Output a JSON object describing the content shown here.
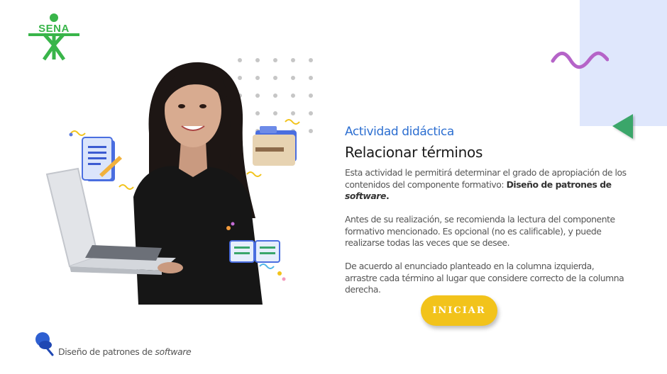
{
  "brand": {
    "logo_text": "SENA"
  },
  "activity": {
    "kicker": "Actividad didáctica",
    "title": "Relacionar términos",
    "p1_text": "Esta actividad le permitirá determinar el grado de apropiación de los contenidos del componente formativo: ",
    "p1_bold": "Diseño de patrones de",
    "p1_bold_italic": "software",
    "p1_end": ".",
    "p2": "Antes de su realización, se recomienda la lectura del componente formativo mencionado.  Es opcional (no es calificable), y puede realizarse todas las veces que se desee.",
    "p3": "De acuerdo al enunciado planteado en la columna izquierda, arrastre cada término al lugar que considere correcto de la columna derecha.",
    "start_button": "INICIAR"
  },
  "footer": {
    "course_prefix": "Diseño de patrones de",
    "course_italic": "software"
  },
  "colors": {
    "accent_blue": "#2d6fd1",
    "button_yellow": "#f2c31b",
    "logo_green": "#39b54a",
    "arrow_green": "#3aa66b",
    "squiggle_purple": "#b564c8",
    "block_blue": "#dfe7fc"
  },
  "icons": {
    "back": "triangle-left-icon",
    "footer": "pushpin-icon",
    "decor": "squiggle-icon"
  }
}
